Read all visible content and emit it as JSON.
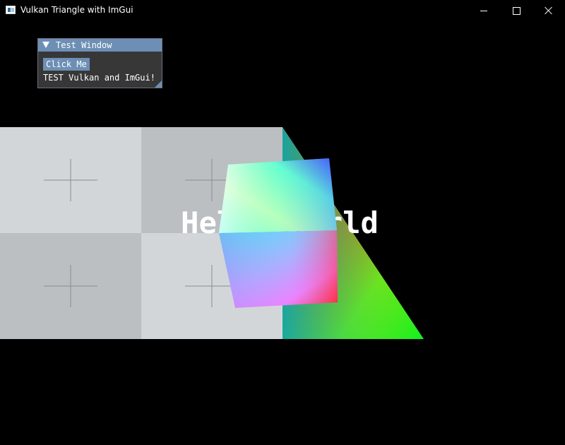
{
  "window": {
    "title": "Vulkan Triangle with ImGui",
    "icon": "app-window-icon",
    "controls": {
      "minimize": "minimize-icon",
      "maximize": "maximize-icon",
      "close": "close-icon"
    }
  },
  "imgui": {
    "title": "Test Window",
    "button_label": "Click Me",
    "text": "TEST Vulkan and ImGui!",
    "colors": {
      "title_bg": "#6e8fb5",
      "body_bg": "#3c3c3c"
    }
  },
  "scene": {
    "overlay_text": "Hello World",
    "colors": {
      "background": "#000000",
      "quad_light": "#d2d6d9",
      "quad_dark": "#bbbfc2"
    }
  }
}
